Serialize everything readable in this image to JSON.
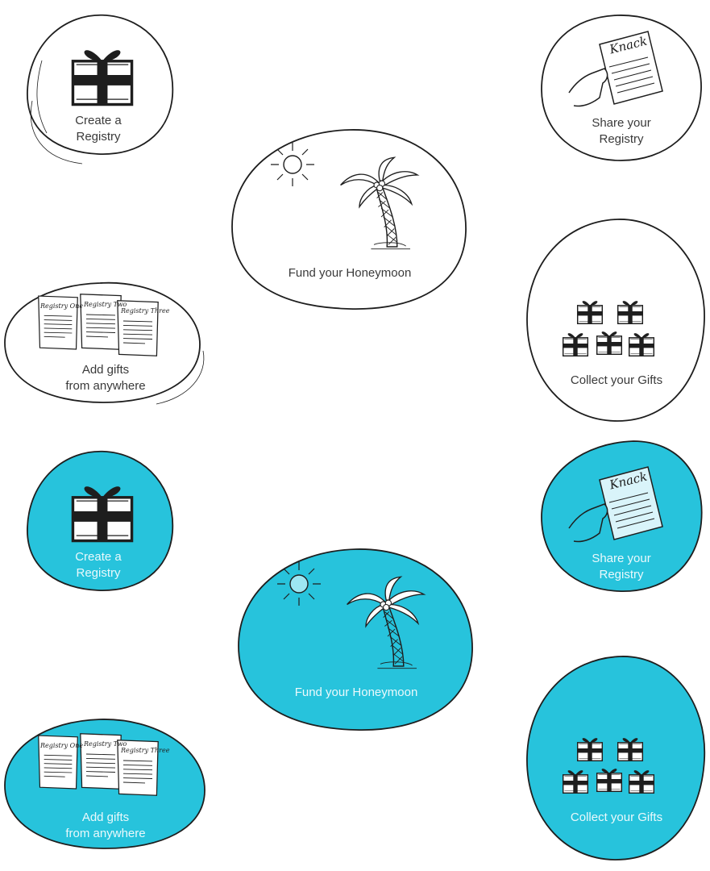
{
  "colors": {
    "accent": "#27c3dc",
    "ink": "#1e1e1e",
    "paper": "#ffffff",
    "paper_blue": "#d9f4fa"
  },
  "sets": [
    {
      "variant": "outline",
      "create_registry": {
        "line1": "Create a",
        "line2": "Registry",
        "icon": "gift-box-icon"
      },
      "share_registry": {
        "line1": "Share your",
        "line2": "Registry",
        "icon": "hand-holding-document-icon",
        "doc_title": "Knack"
      },
      "fund_honeymoon": {
        "label": "Fund your Honeymoon",
        "icon": "palm-tree-sun-icon"
      },
      "add_gifts": {
        "line1": "Add gifts",
        "line2": "from anywhere",
        "icon": "registry-papers-icon",
        "papers": [
          "Registry One",
          "Registry Two",
          "Registry Three"
        ]
      },
      "collect_gifts": {
        "label": "Collect your Gifts",
        "icon": "gift-boxes-icon"
      }
    },
    {
      "variant": "filled",
      "create_registry": {
        "line1": "Create a",
        "line2": "Registry",
        "icon": "gift-box-icon"
      },
      "share_registry": {
        "line1": "Share your",
        "line2": "Registry",
        "icon": "hand-holding-document-icon",
        "doc_title": "Knack"
      },
      "fund_honeymoon": {
        "label": "Fund your Honeymoon",
        "icon": "palm-tree-sun-icon"
      },
      "add_gifts": {
        "line1": "Add gifts",
        "line2": "from anywhere",
        "icon": "registry-papers-icon",
        "papers": [
          "Registry One",
          "Registry Two",
          "Registry Three"
        ]
      },
      "collect_gifts": {
        "label": "Collect your Gifts",
        "icon": "gift-boxes-icon"
      }
    }
  ]
}
